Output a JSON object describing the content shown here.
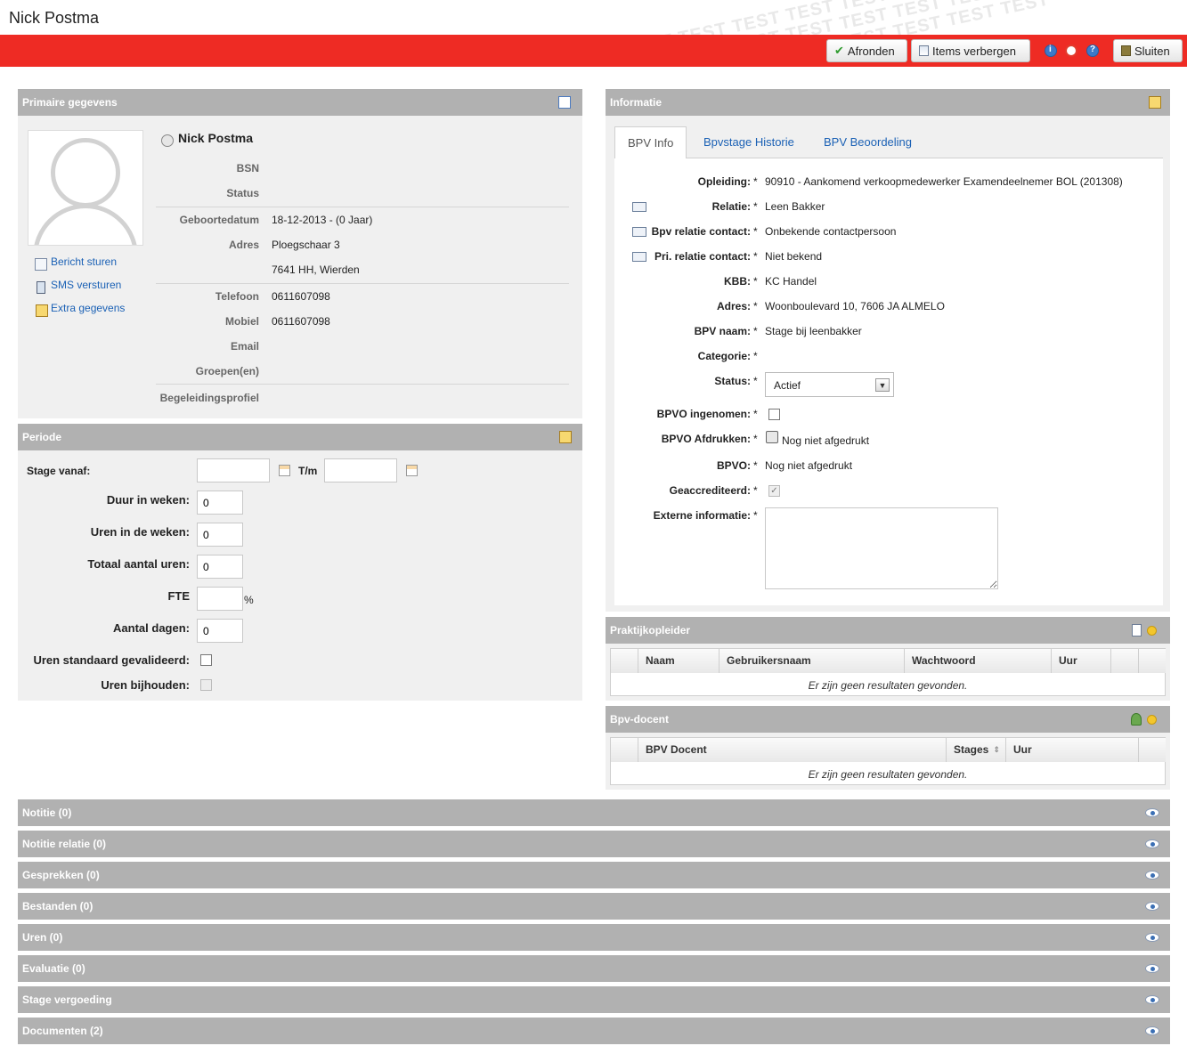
{
  "header": {
    "title": "Nick Postma",
    "watermark": "TEST TEST TEST TEST TEST TEST TEST TEST TEST TEST",
    "buttons": {
      "finish": "Afronden",
      "hide_items": "Items verbergen",
      "close": "Sluiten"
    }
  },
  "primary": {
    "heading": "Primaire gegevens",
    "name": "Nick Postma",
    "links": {
      "message": "Bericht sturen",
      "sms": "SMS versturen",
      "extra": "Extra gegevens"
    },
    "fields": {
      "bsn": {
        "label": "BSN",
        "value": ""
      },
      "status": {
        "label": "Status",
        "value": ""
      },
      "birthdate": {
        "label": "Geboortedatum",
        "value": "18-12-2013 - (0 Jaar)"
      },
      "address": {
        "label": "Adres",
        "line1": "Ploegschaar 3",
        "line2": "7641 HH, Wierden"
      },
      "phone": {
        "label": "Telefoon",
        "value": "0611607098"
      },
      "mobile": {
        "label": "Mobiel",
        "value": "0611607098"
      },
      "email": {
        "label": "Email",
        "value": ""
      },
      "groups": {
        "label": "Groepen(en)",
        "value": ""
      },
      "profile": {
        "label": "Begeleidingsprofiel",
        "value": ""
      }
    }
  },
  "period": {
    "heading": "Periode",
    "start_label": "Stage vanaf:",
    "start_value": "",
    "end_label": "T/m",
    "end_value": "",
    "duration_label": "Duur in weken:",
    "duration_value": "0",
    "hours_week_label": "Uren in de weken:",
    "hours_week_value": "0",
    "total_hours_label": "Totaal aantal uren:",
    "total_hours_value": "0",
    "fte_label": "FTE",
    "fte_value": "",
    "fte_unit": "%",
    "days_label": "Aantal dagen:",
    "days_value": "0",
    "validated_label": "Uren standaard gevalideerd:",
    "track_label": "Uren bijhouden:"
  },
  "info": {
    "heading": "Informatie",
    "tabs": [
      "BPV Info",
      "Bpvstage Historie",
      "BPV Beoordeling"
    ],
    "star": "*",
    "rows": {
      "education": {
        "label": "Opleiding:",
        "value": "90910 - Aankomend verkoopmedewerker Examendeelnemer BOL (201308)"
      },
      "relation": {
        "label": "Relatie:",
        "value": "Leen Bakker"
      },
      "contact": {
        "label": "Bpv relatie contact:",
        "value": "Onbekende contactpersoon"
      },
      "pri_contact": {
        "label": "Pri. relatie contact:",
        "value": "Niet bekend"
      },
      "kbb": {
        "label": "KBB:",
        "value": "KC Handel"
      },
      "address": {
        "label": "Adres:",
        "value": "Woonboulevard 10, 7606 JA ALMELO"
      },
      "bpv_name": {
        "label": "BPV naam:",
        "value": "Stage bij leenbakker"
      },
      "category": {
        "label": "Categorie:",
        "value": ""
      },
      "status": {
        "label": "Status:",
        "value": "Actief"
      },
      "bpvo_received": {
        "label": "BPVO ingenomen:"
      },
      "bpvo_print": {
        "label": "BPVO Afdrukken:",
        "value": "Nog niet afgedrukt"
      },
      "bpvo": {
        "label": "BPVO:",
        "value": "Nog niet afgedrukt"
      },
      "accredited": {
        "label": "Geaccrediteerd:"
      },
      "external": {
        "label": "Externe informatie:",
        "value": ""
      }
    }
  },
  "supervisor": {
    "heading": "Praktijkopleider",
    "columns": [
      "Naam",
      "Gebruikersnaam",
      "Wachtwoord",
      "Uur"
    ],
    "empty": "Er zijn geen resultaten gevonden."
  },
  "teacher": {
    "heading": "Bpv-docent",
    "columns": [
      "BPV Docent",
      "Stages",
      "Uur"
    ],
    "empty": "Er zijn geen resultaten gevonden."
  },
  "sections": [
    "Notitie (0)",
    "Notitie relatie (0)",
    "Gesprekken (0)",
    "Bestanden (0)",
    "Uren (0)",
    "Evaluatie (0)",
    "Stage vergoeding",
    "Documenten (2)"
  ],
  "colors": {
    "accent_red": "#ee2b24",
    "panel_header": "#b1b1b1",
    "link": "#1b61b5"
  }
}
